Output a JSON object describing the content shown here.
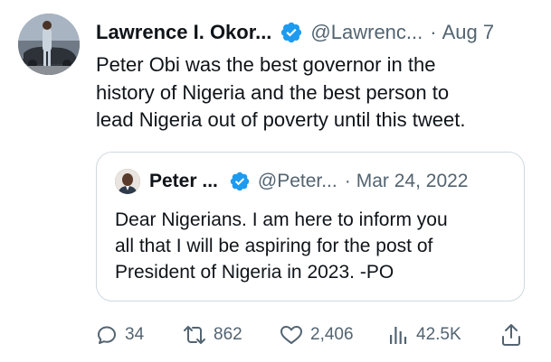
{
  "tweet": {
    "author_name": "Lawrence I. Okor...",
    "handle": "@Lawrenc...",
    "separator": "·",
    "date": "Aug 7",
    "text_lines": [
      "Peter Obi was the best governor in the",
      "history of Nigeria and the best person to",
      "lead Nigeria out of poverty until this tweet."
    ],
    "avatar_icon": "profile-photo-man-in-suit-by-car"
  },
  "quoted_tweet": {
    "author_name": "Peter ...",
    "handle": "@Peter...",
    "separator": "·",
    "date": "Mar 24, 2022",
    "text_lines": [
      "Dear Nigerians. I am here to inform you",
      "all that I will be aspiring for the post of",
      "President of Nigeria in 2023. -PO"
    ],
    "avatar_icon": "profile-photo-man"
  },
  "actions": {
    "replies": "34",
    "retweets": "862",
    "likes": "2,406",
    "views": "42.5K"
  },
  "colors": {
    "verified_blue": "#1d9bf0",
    "secondary_text": "#536471",
    "primary_text": "#0f1419",
    "border": "#cfd9de"
  }
}
